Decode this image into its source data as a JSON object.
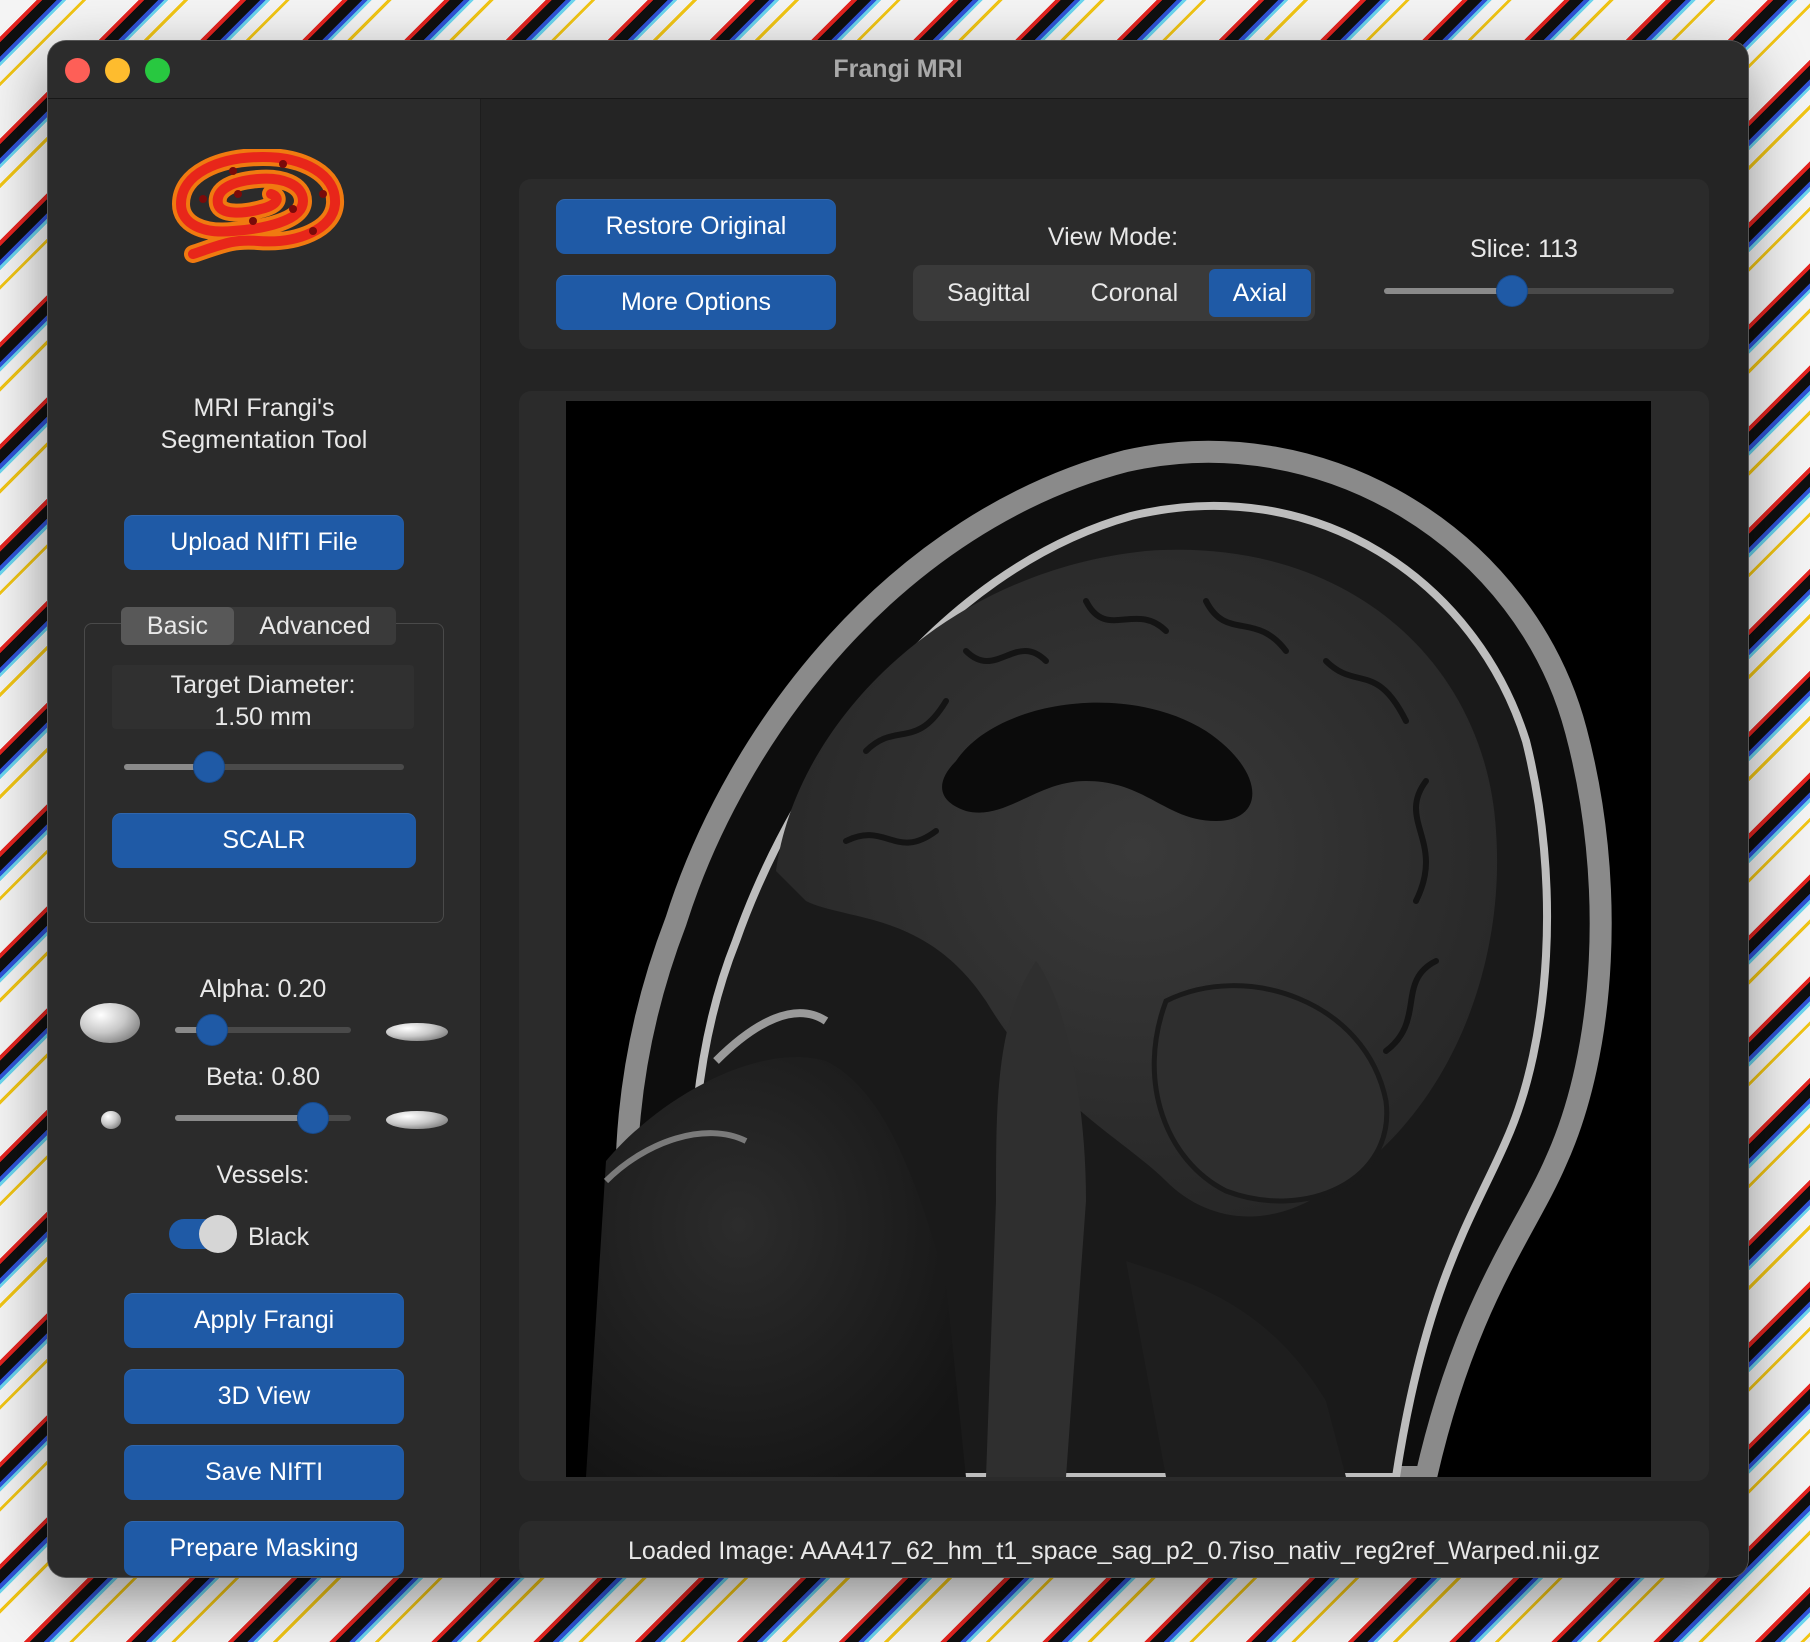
{
  "window": {
    "title": "Frangi MRI"
  },
  "sidebar": {
    "app_name_line1": "MRI Frangi's",
    "app_name_line2": "Segmentation Tool",
    "upload_button": "Upload NIfTI File",
    "tabs": [
      {
        "label": "Basic",
        "active": true
      },
      {
        "label": "Advanced",
        "active": false
      }
    ],
    "target_diameter": {
      "label": "Target Diameter:",
      "value": "1.50 mm",
      "slider_fraction": 0.3
    },
    "scalr_button": "SCALR",
    "alpha": {
      "label": "Alpha: 0.20",
      "slider_fraction": 0.2
    },
    "beta": {
      "label": "Beta: 0.80",
      "slider_fraction": 0.8
    },
    "vessels": {
      "label": "Vessels:",
      "toggle_label": "Black",
      "toggle_on": true
    },
    "buttons": {
      "apply_frangi": "Apply Frangi",
      "view_3d": "3D View",
      "save_nifti": "Save NIfTI",
      "prepare_masking": "Prepare Masking"
    }
  },
  "toolbar": {
    "restore_button": "Restore Original",
    "more_options_button": "More Options",
    "view_mode": {
      "label": "View Mode:",
      "options": [
        {
          "label": "Sagittal",
          "active": false
        },
        {
          "label": "Coronal",
          "active": false
        },
        {
          "label": "Axial",
          "active": true
        }
      ]
    },
    "slice": {
      "label": "Slice: 113",
      "slider_fraction": 0.45
    }
  },
  "status": {
    "loaded_image": "Loaded Image: AAA417_62_hm_t1_space_sag_p2_0.7iso_nativ_reg2ref_Warped.nii.gz"
  },
  "colors": {
    "accent": "#1f5aa6",
    "window_bg": "#242424",
    "panel_bg": "#2b2b2b",
    "logo": "#e8401a"
  }
}
